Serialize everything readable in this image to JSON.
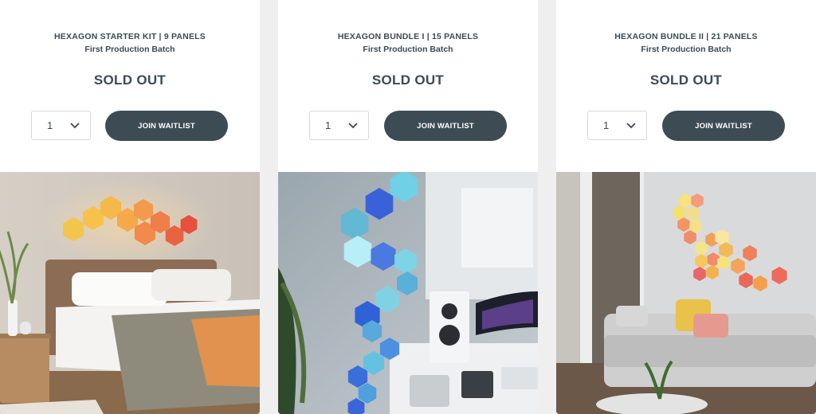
{
  "products": [
    {
      "title": "HEXAGON STARTER KIT | 9 PANELS",
      "subtitle": "First Production Batch",
      "status": "SOLD OUT",
      "quantity": "1",
      "button_label": "JOIN WAITLIST",
      "image_scene": "bedroom-with-warm-hexagon-panels"
    },
    {
      "title": "HEXAGON BUNDLE I | 15 PANELS",
      "subtitle": "First Production Batch",
      "status": "SOLD OUT",
      "quantity": "1",
      "button_label": "JOIN WAITLIST",
      "image_scene": "music-studio-with-blue-hexagon-panels"
    },
    {
      "title": "HEXAGON BUNDLE II | 21 PANELS",
      "subtitle": "First Production Batch",
      "status": "SOLD OUT",
      "quantity": "1",
      "button_label": "JOIN WAITLIST",
      "image_scene": "living-room-with-multicolor-hexagon-panels"
    }
  ],
  "colors": {
    "page_bg": "#efefef",
    "card_bg": "#ffffff",
    "text_dark": "#3b4a55",
    "button_bg": "#3d4b55",
    "button_text": "#ffffff"
  }
}
